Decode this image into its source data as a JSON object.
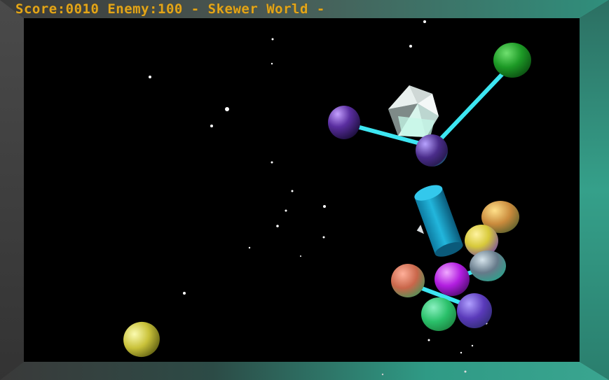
{
  "hud": {
    "score_label": "Score:",
    "score_value": "0010",
    "enemy_label": "Enemy:",
    "enemy_value": "100",
    "title": "- Skewer World -"
  },
  "colors": {
    "hud_text": "#e2a51a",
    "space": "#000000",
    "skewer": "#3de6f2",
    "frame_left": "#3c3c3c",
    "frame_right": "#2f9a85"
  },
  "icons": {
    "player": "cylinder-player",
    "cube": "white-crystal-cube",
    "enemy": "sphere-enemy"
  }
}
